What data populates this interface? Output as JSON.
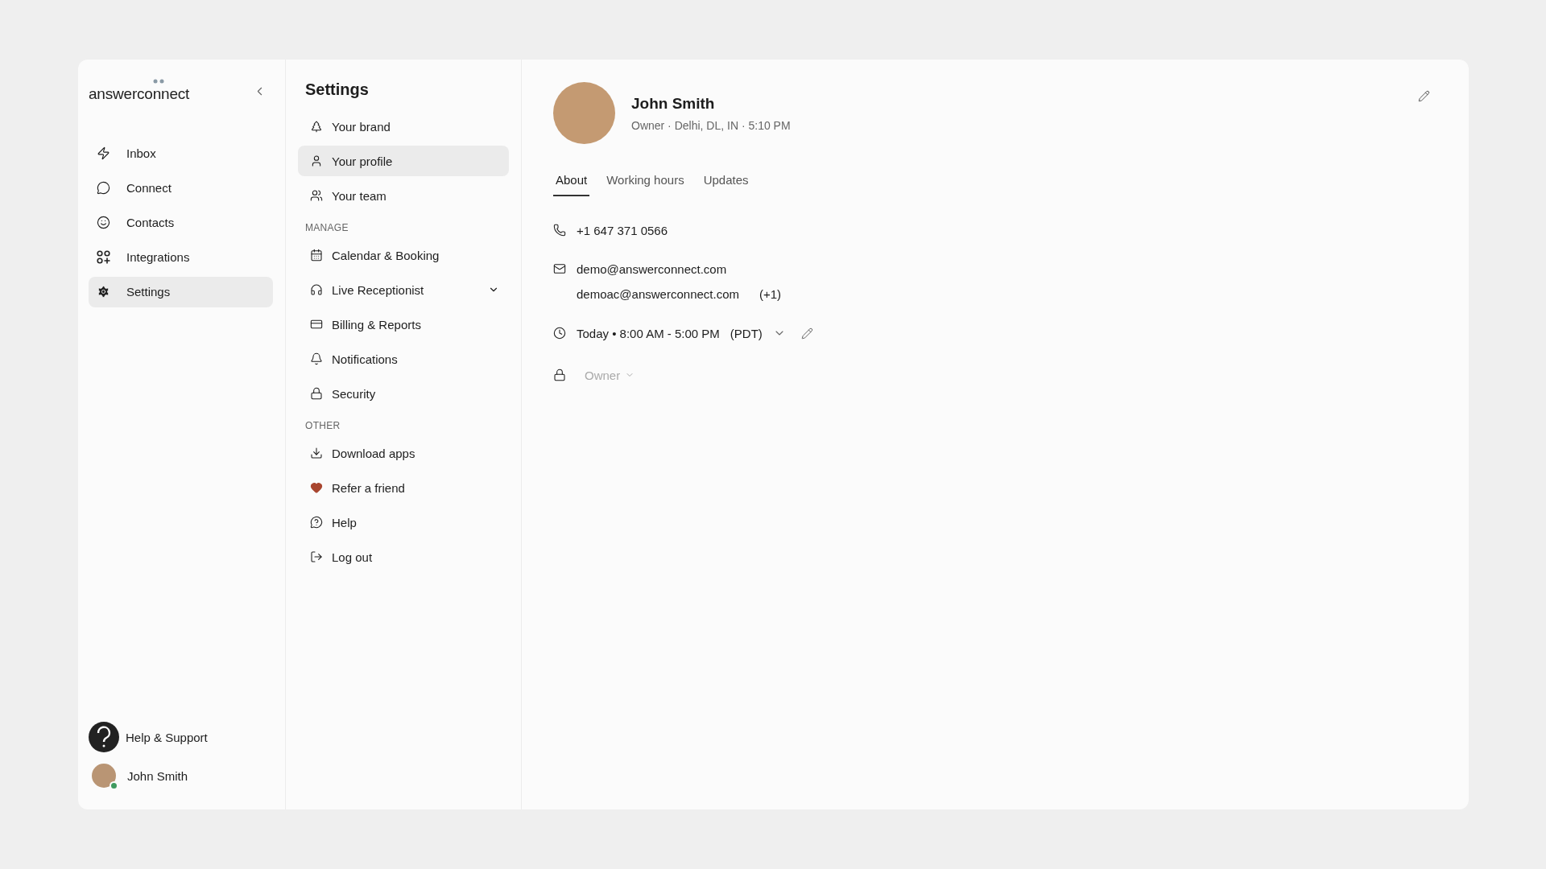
{
  "sidebar": {
    "logo": "answerconnect",
    "items": [
      {
        "label": "Inbox",
        "selected": false
      },
      {
        "label": "Connect",
        "selected": false
      },
      {
        "label": "Contacts",
        "selected": false
      },
      {
        "label": "Integrations",
        "selected": false
      },
      {
        "label": "Settings",
        "selected": true
      }
    ],
    "help": "Help & Support",
    "user": {
      "name": "John Smith",
      "online": true
    }
  },
  "settings_menu": {
    "title": "Settings",
    "sections": [
      {
        "items": [
          {
            "label": "Your brand",
            "selected": false
          },
          {
            "label": "Your profile",
            "selected": true
          },
          {
            "label": "Your team",
            "selected": false
          }
        ]
      },
      {
        "heading": "MANAGE",
        "items": [
          {
            "label": "Calendar & Booking",
            "selected": false
          },
          {
            "label": "Live Receptionist",
            "selected": false,
            "expanded": false
          },
          {
            "label": "Billing & Reports",
            "selected": false
          },
          {
            "label": "Notifications",
            "selected": false
          },
          {
            "label": "Security",
            "selected": false
          }
        ]
      },
      {
        "heading": "OTHER",
        "items": [
          {
            "label": "Download apps",
            "selected": false
          },
          {
            "label": "Refer a friend",
            "selected": false
          },
          {
            "label": "Help",
            "selected": false
          },
          {
            "label": "Log out",
            "selected": false
          }
        ]
      }
    ]
  },
  "profile": {
    "name": "John Smith",
    "subtitle": "Owner · Delhi, DL, IN · 5:10 PM",
    "tabs": [
      {
        "label": "About",
        "selected": true
      },
      {
        "label": "Working hours",
        "selected": false
      },
      {
        "label": "Updates",
        "selected": false
      }
    ],
    "phone": "+1 647 371 0566",
    "emails": [
      {
        "address": "demo@answerconnect.com"
      },
      {
        "address": "demoac@answerconnect.com",
        "extra": "(+1)"
      }
    ],
    "schedule": {
      "text": "Today • 8:00 AM - 5:00 PM",
      "zone": "(PDT)"
    },
    "role": {
      "value": "Owner",
      "disabled": true
    }
  }
}
